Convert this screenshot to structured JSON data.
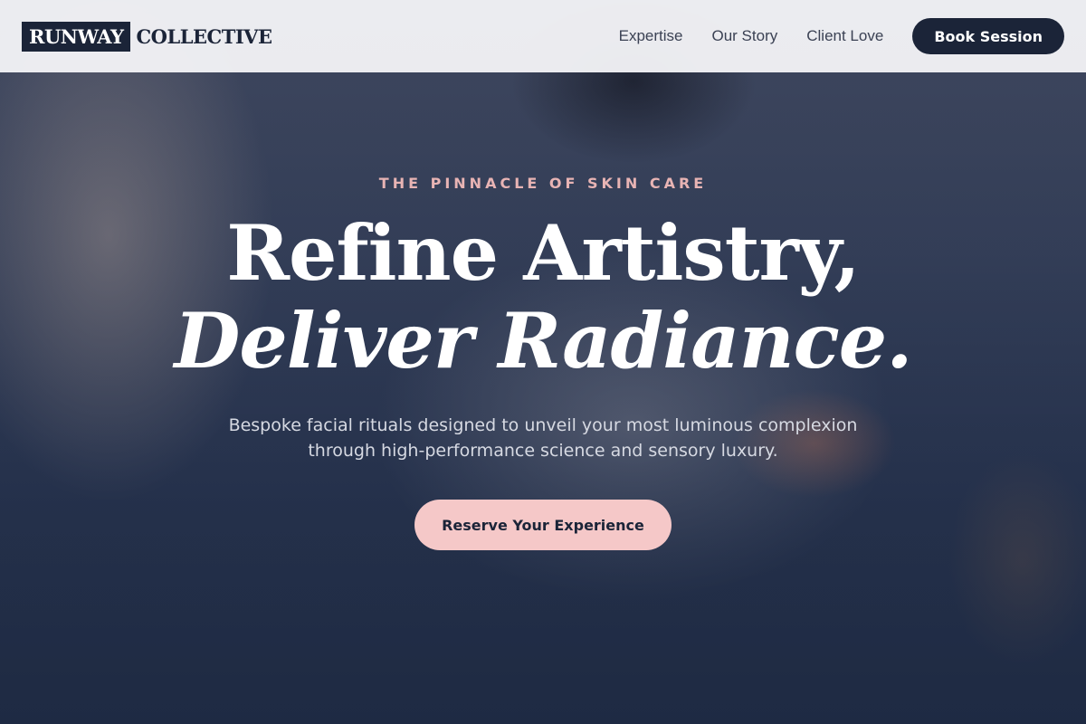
{
  "brand": {
    "logo_box_text": "RUNWAY",
    "logo_text": "COLLECTIVE"
  },
  "nav": {
    "items": [
      "Expertise",
      "Our Story",
      "Client Love"
    ],
    "cta_label": "Book Session"
  },
  "hero": {
    "eyebrow": "THE PINNACLE OF SKIN CARE",
    "headline_line1": "Refine Artistry,",
    "headline_line2": "Deliver Radiance.",
    "subtext": "Bespoke facial rituals designed to unveil your most luminous complexion through high-performance science and sensory luxury.",
    "cta_label": "Reserve Your Experience"
  },
  "colors": {
    "navy": "#1b2438",
    "accent_pink": "#f5c8c8",
    "eyebrow_pink": "#e8b4b4",
    "header_bg": "#f2f3f6"
  }
}
